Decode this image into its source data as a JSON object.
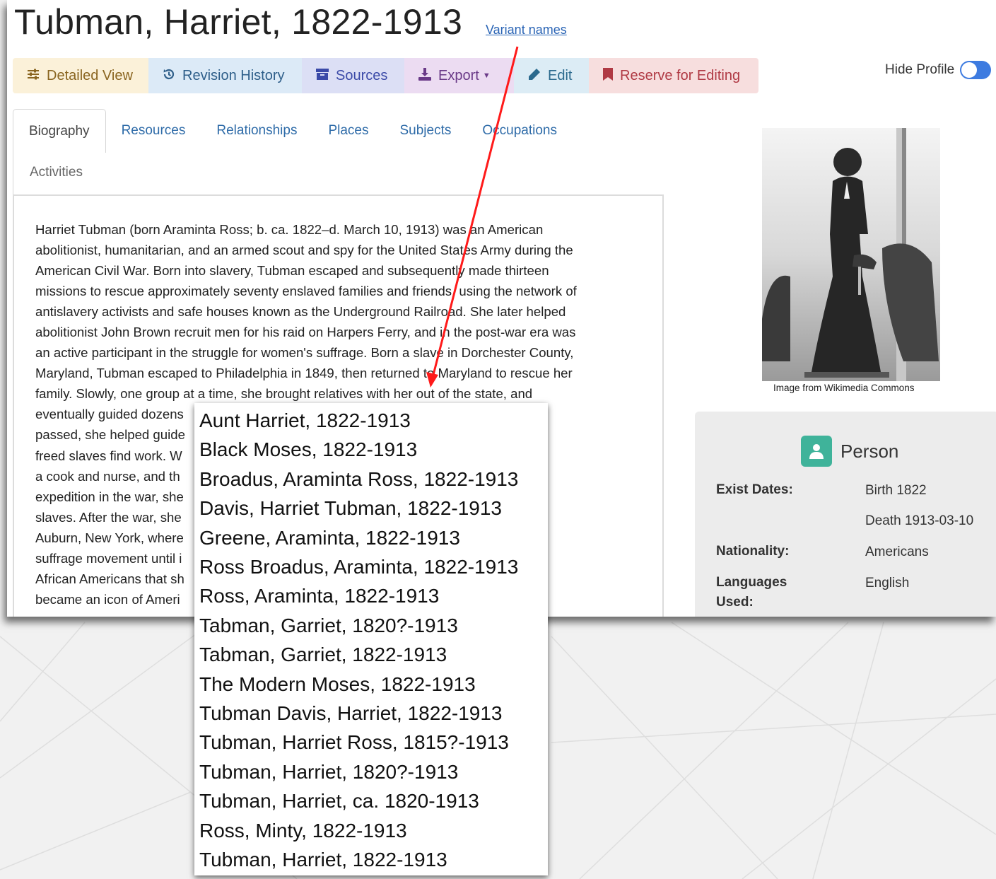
{
  "page": {
    "title": "Tubman, Harriet, 1822-1913",
    "variant_link": "Variant names"
  },
  "toolbar": {
    "detailed_view": "Detailed View",
    "revision_history": "Revision History",
    "sources": "Sources",
    "export": "Export",
    "edit": "Edit",
    "reserve": "Reserve for Editing"
  },
  "hide_profile": {
    "label": "Hide Profile",
    "enabled": true
  },
  "tabs": {
    "biography": "Biography",
    "resources": "Resources",
    "relationships": "Relationships",
    "places": "Places",
    "subjects": "Subjects",
    "occupations": "Occupations",
    "activities": "Activities"
  },
  "biography": {
    "lines": [
      "Harriet Tubman (born Araminta Ross; b. ca. 1822–d. March 10, 1913) was an American",
      "abolitionist, humanitarian, and an armed scout and spy for the United States Army during the",
      "American Civil War. Born into slavery, Tubman escaped and subsequently made thirteen",
      "missions to rescue approximately seventy enslaved families and friends, using the network of",
      "antislavery activists and safe houses known as the Underground Railroad. She later helped",
      "abolitionist John Brown recruit men for his raid on Harpers Ferry, and in the post-war era was",
      "an active participant in the struggle for women's suffrage. Born a slave in Dorchester County,",
      "Maryland, Tubman escaped to Philadelphia in 1849, then returned to Maryland to rescue her",
      "family. Slowly, one group at a time, she brought relatives with her out of the state, and",
      "eventually guided dozens                                                                    t of 1850 was",
      "passed, she helped guide                                                                    helped newly",
      "freed slaves find work. W                                                                   Army, first as",
      "a cook and nurse, and th                                                                    an armed",
      "expedition in the war, she                                                                 ore than 700",
      "slaves. After the war, she                                                                 sed in 1859 in",
      "Auburn, New York, where                                                                     women's",
      "suffrage movement until i                                                                   me for elderly",
      "African Americans that sh                                                                   n 1913, she",
      "became an icon of Ameri"
    ]
  },
  "portrait": {
    "caption": "Image from Wikimedia Commons"
  },
  "person": {
    "heading": "Person",
    "exist_dates_label": "Exist Dates:",
    "birth": "Birth 1822",
    "death": "Death 1913-03-10",
    "nationality_label": "Nationality:",
    "nationality": "Americans",
    "languages_label_1": "Languages",
    "languages_label_2": "Used:",
    "language": "English"
  },
  "variant_names": [
    "Aunt Harriet, 1822-1913",
    "Black Moses, 1822-1913",
    "Broadus, Araminta Ross, 1822-1913",
    "Davis, Harriet Tubman, 1822-1913",
    "Greene, Araminta, 1822-1913",
    "Ross Broadus, Araminta, 1822-1913",
    "Ross, Araminta, 1822-1913",
    "Tabman, Garriet, 1820?-1913",
    "Tabman, Garriet, 1822-1913",
    "The Modern Moses, 1822-1913",
    "Tubman Davis, Harriet, 1822-1913",
    "Tubman, Harriet Ross, 1815?-1913",
    "Tubman, Harriet, 1820?-1913",
    "Tubman, Harriet, ca. 1820-1913",
    "Ross, Minty, 1822-1913",
    "Tubman, Harriet, 1822-1913"
  ],
  "colors": {
    "arrow": "#ff1a1a",
    "link": "#2a64b5",
    "person_icon": "#3fb39a",
    "toggle": "#3d7be0"
  },
  "icons": {
    "detailed_view": "sliders-icon",
    "revision_history": "history-icon",
    "sources": "archive-icon",
    "export": "download-icon",
    "edit": "pencil-icon",
    "reserve": "bookmark-icon",
    "person": "user-icon"
  }
}
